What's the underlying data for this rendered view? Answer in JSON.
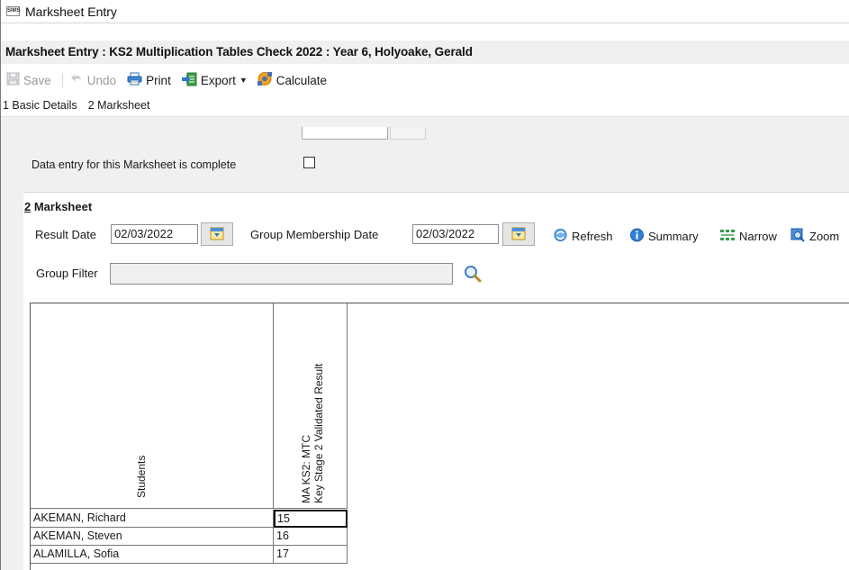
{
  "window": {
    "app_icon_text": "SIMS",
    "title": "Marksheet Entry"
  },
  "form": {
    "title": "Marksheet Entry : KS2 Multiplication Tables Check 2022 : Year 6, Holyoake, Gerald"
  },
  "toolbar": {
    "save_label": "Save",
    "undo_label": "Undo",
    "print_label": "Print",
    "export_label": "Export",
    "calculate_label": "Calculate"
  },
  "tabs": [
    {
      "label": "1 Basic Details"
    },
    {
      "label": "2 Marksheet"
    }
  ],
  "basic_details": {
    "complete_label": "Data entry for this Marksheet is complete",
    "complete_checked": false
  },
  "marksheet": {
    "section_number": "2",
    "section_title": " Marksheet",
    "result_date_label": "Result Date",
    "result_date_value": "02/03/2022",
    "group_membership_label": "Group Membership Date",
    "group_membership_value": "02/03/2022",
    "refresh_label": "Refresh",
    "summary_label": "Summary",
    "narrow_label": "Narrow",
    "zoom_label": "Zoom",
    "group_filter_label": "Group Filter",
    "group_filter_value": ""
  },
  "grid": {
    "students_header": "Students",
    "column_header_line1": "MA KS2: MTC",
    "column_header_line2": "Key Stage 2 Validated Result",
    "rows": [
      {
        "name": "AKEMAN, Richard",
        "value": "15"
      },
      {
        "name": "AKEMAN, Steven",
        "value": "16"
      },
      {
        "name": "ALAMILLA, Sofia",
        "value": "17"
      }
    ]
  }
}
